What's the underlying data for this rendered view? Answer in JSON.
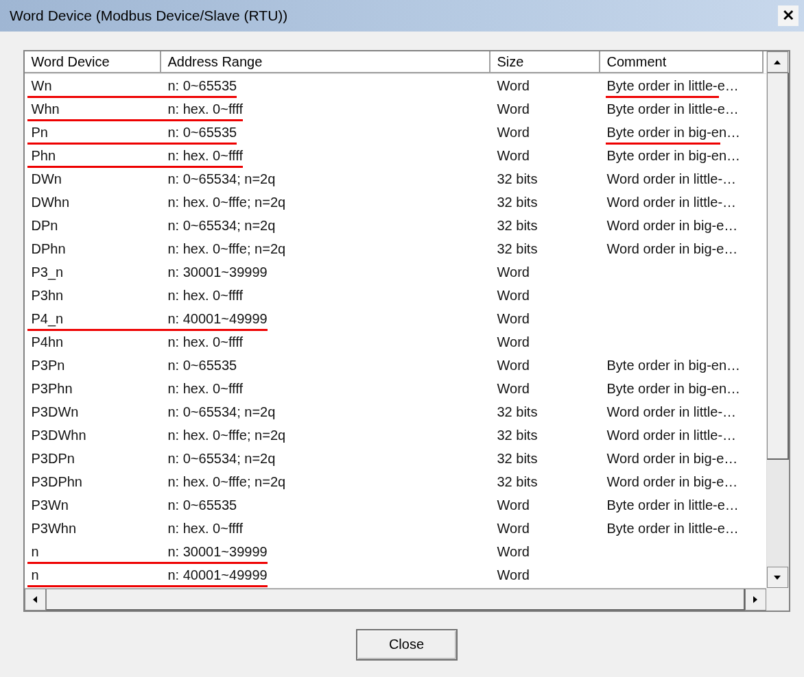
{
  "window": {
    "title": "Word Device (Modbus Device/Slave (RTU))",
    "close_glyph": "✕"
  },
  "table": {
    "columns": [
      "Word Device",
      "Address Range",
      "Size",
      "Comment"
    ],
    "rows": [
      {
        "device": "Wn",
        "range": "n: 0~65535",
        "size": "Word",
        "comment": "Byte order in little-e…",
        "underlined": true,
        "comment_underlined": true
      },
      {
        "device": "Whn",
        "range": "n: hex. 0~ffff",
        "size": "Word",
        "comment": "Byte order in little-e…",
        "underlined": true,
        "comment_underlined": false
      },
      {
        "device": "Pn",
        "range": "n: 0~65535",
        "size": "Word",
        "comment": "Byte order in big-en…",
        "underlined": true,
        "comment_underlined": true
      },
      {
        "device": "Phn",
        "range": "n: hex. 0~ffff",
        "size": "Word",
        "comment": "Byte order in big-en…",
        "underlined": true,
        "comment_underlined": false
      },
      {
        "device": "DWn",
        "range": "n: 0~65534; n=2q",
        "size": "32 bits",
        "comment": "Word order in little-…",
        "underlined": false,
        "comment_underlined": false
      },
      {
        "device": "DWhn",
        "range": "n: hex. 0~fffe; n=2q",
        "size": "32 bits",
        "comment": "Word order in little-…",
        "underlined": false,
        "comment_underlined": false
      },
      {
        "device": "DPn",
        "range": "n: 0~65534; n=2q",
        "size": "32 bits",
        "comment": "Word order in big-e…",
        "underlined": false,
        "comment_underlined": false
      },
      {
        "device": "DPhn",
        "range": "n: hex. 0~fffe; n=2q",
        "size": "32 bits",
        "comment": "Word order in big-e…",
        "underlined": false,
        "comment_underlined": false
      },
      {
        "device": "P3_n",
        "range": "n: 30001~39999",
        "size": "Word",
        "underlined": false,
        "comment_underlined": false
      },
      {
        "device": "P3hn",
        "range": "n: hex. 0~ffff",
        "size": "Word",
        "underlined": false,
        "comment_underlined": false
      },
      {
        "device": "P4_n",
        "range": "n: 40001~49999",
        "size": "Word",
        "underlined": true,
        "comment_underlined": false
      },
      {
        "device": "P4hn",
        "range": "n: hex. 0~ffff",
        "size": "Word",
        "underlined": false,
        "comment_underlined": false
      },
      {
        "device": "P3Pn",
        "range": "n: 0~65535",
        "size": "Word",
        "comment": "Byte order in big-en…",
        "underlined": false,
        "comment_underlined": false
      },
      {
        "device": "P3Phn",
        "range": "n: hex. 0~ffff",
        "size": "Word",
        "comment": "Byte order in big-en…",
        "underlined": false,
        "comment_underlined": false
      },
      {
        "device": "P3DWn",
        "range": "n: 0~65534; n=2q",
        "size": "32 bits",
        "comment": "Word order in little-…",
        "underlined": false,
        "comment_underlined": false
      },
      {
        "device": "P3DWhn",
        "range": "n: hex. 0~fffe; n=2q",
        "size": "32 bits",
        "comment": "Word order in little-…",
        "underlined": false,
        "comment_underlined": false
      },
      {
        "device": "P3DPn",
        "range": "n: 0~65534; n=2q",
        "size": "32 bits",
        "comment": "Word order in big-e…",
        "underlined": false,
        "comment_underlined": false
      },
      {
        "device": "P3DPhn",
        "range": "n: hex. 0~fffe; n=2q",
        "size": "32 bits",
        "comment": "Word order in big-e…",
        "underlined": false,
        "comment_underlined": false
      },
      {
        "device": "P3Wn",
        "range": "n: 0~65535",
        "size": "Word",
        "comment": "Byte order in little-e…",
        "underlined": false,
        "comment_underlined": false
      },
      {
        "device": "P3Whn",
        "range": "n: hex. 0~ffff",
        "size": "Word",
        "comment": "Byte order in little-e…",
        "underlined": false,
        "comment_underlined": false
      },
      {
        "device": "n",
        "range": "n: 30001~39999",
        "size": "Word",
        "underlined": true,
        "comment_underlined": false
      },
      {
        "device": "n",
        "range": "n: 40001~49999",
        "size": "Word",
        "underlined": true,
        "comment_underlined": false
      }
    ]
  },
  "buttons": [
    "Close"
  ]
}
